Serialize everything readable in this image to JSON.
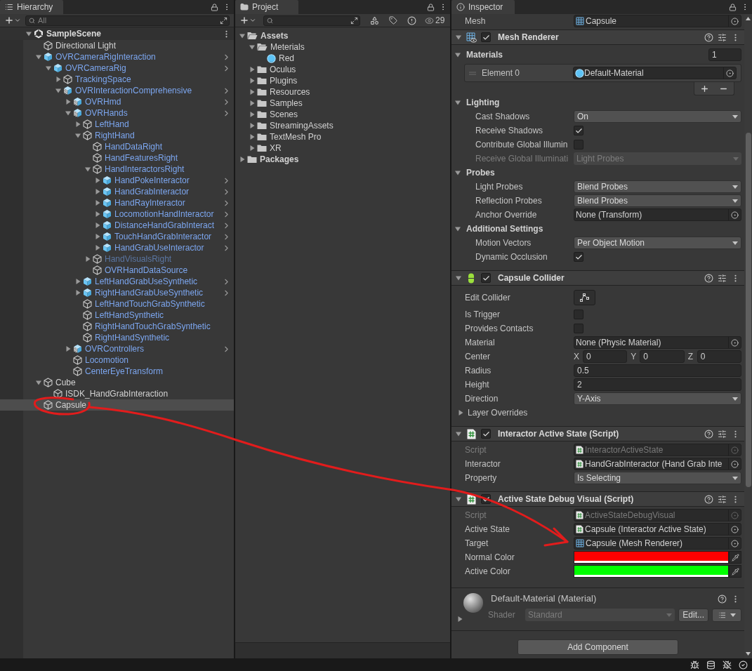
{
  "hierarchy": {
    "tab": "Hierarchy",
    "search": {
      "placeholder": "All"
    },
    "items": [
      {
        "name": "SampleScene",
        "kind": "scene",
        "expanded": true,
        "selected": false,
        "children": [
          {
            "name": "Directional Light",
            "kind": "object",
            "prefab_instance": false,
            "selected": false
          },
          {
            "name": "OVRCameraRigInteraction",
            "kind": "prefab",
            "prefab_instance": true,
            "expanded": true,
            "selected": false,
            "children": [
              {
                "name": "OVRCameraRig",
                "kind": "prefab",
                "prefab_instance": true,
                "expanded": true,
                "selected": false,
                "children": [
                  {
                    "name": "TrackingSpace",
                    "kind": "object",
                    "prefab_instance": true,
                    "expanded": false,
                    "selected": false
                  },
                  {
                    "name": "OVRInteractionComprehensive",
                    "kind": "prefab-variant",
                    "prefab_instance": true,
                    "expanded": true,
                    "selected": false,
                    "children": [
                      {
                        "name": "OVRHmd",
                        "kind": "prefab-variant",
                        "prefab_instance": true,
                        "expanded": false,
                        "selected": false
                      },
                      {
                        "name": "OVRHands",
                        "kind": "prefab-variant",
                        "prefab_instance": true,
                        "expanded": true,
                        "selected": false,
                        "children": [
                          {
                            "name": "LeftHand",
                            "kind": "object",
                            "prefab_instance": true,
                            "expanded": false,
                            "selected": false
                          },
                          {
                            "name": "RightHand",
                            "kind": "object",
                            "prefab_instance": true,
                            "expanded": true,
                            "selected": false,
                            "children": [
                              {
                                "name": "HandDataRight",
                                "kind": "object",
                                "prefab_instance": true,
                                "selected": false
                              },
                              {
                                "name": "HandFeaturesRight",
                                "kind": "object",
                                "prefab_instance": true,
                                "selected": false
                              },
                              {
                                "name": "HandInteractorsRight",
                                "kind": "object",
                                "prefab_instance": true,
                                "expanded": true,
                                "selected": false,
                                "children": [
                                  {
                                    "name": "HandPokeInteractor",
                                    "kind": "prefab",
                                    "prefab_instance": true,
                                    "expanded": false,
                                    "selected": false
                                  },
                                  {
                                    "name": "HandGrabInteractor",
                                    "kind": "prefab",
                                    "prefab_instance": true,
                                    "expanded": false,
                                    "selected": false
                                  },
                                  {
                                    "name": "HandRayInteractor",
                                    "kind": "prefab",
                                    "prefab_instance": true,
                                    "expanded": false,
                                    "selected": false
                                  },
                                  {
                                    "name": "LocomotionHandInteractor",
                                    "kind": "prefab",
                                    "prefab_instance": true,
                                    "expanded": false,
                                    "selected": false
                                  },
                                  {
                                    "name": "DistanceHandGrabInteract",
                                    "kind": "prefab",
                                    "prefab_instance": true,
                                    "expanded": false,
                                    "selected": false
                                  },
                                  {
                                    "name": "TouchHandGrabInteractor",
                                    "kind": "prefab",
                                    "prefab_instance": true,
                                    "expanded": false,
                                    "selected": false
                                  },
                                  {
                                    "name": "HandGrabUseInteractor",
                                    "kind": "prefab",
                                    "prefab_instance": true,
                                    "expanded": false,
                                    "selected": false
                                  }
                                ]
                              },
                              {
                                "name": "HandVisualsRight",
                                "kind": "object",
                                "prefab_instance": true,
                                "expanded": false,
                                "disabled": true,
                                "selected": false
                              },
                              {
                                "name": "OVRHandDataSource",
                                "kind": "object",
                                "prefab_instance": true,
                                "selected": false
                              }
                            ]
                          },
                          {
                            "name": "LeftHandGrabUseSynthetic",
                            "kind": "prefab",
                            "prefab_instance": true,
                            "expanded": false,
                            "selected": false
                          },
                          {
                            "name": "RightHandGrabUseSynthetic",
                            "kind": "prefab",
                            "prefab_instance": true,
                            "expanded": false,
                            "selected": false
                          },
                          {
                            "name": "LeftHandTouchGrabSynthetic",
                            "kind": "object",
                            "prefab_instance": true,
                            "selected": false
                          },
                          {
                            "name": "LeftHandSynthetic",
                            "kind": "object",
                            "prefab_instance": true,
                            "selected": false
                          },
                          {
                            "name": "RightHandTouchGrabSynthetic",
                            "kind": "object",
                            "prefab_instance": true,
                            "selected": false
                          },
                          {
                            "name": "RightHandSynthetic",
                            "kind": "object",
                            "prefab_instance": true,
                            "selected": false
                          }
                        ]
                      },
                      {
                        "name": "OVRControllers",
                        "kind": "prefab-variant",
                        "prefab_instance": true,
                        "expanded": false,
                        "selected": false
                      },
                      {
                        "name": "Locomotion",
                        "kind": "object",
                        "prefab_instance": true,
                        "selected": false
                      },
                      {
                        "name": "CenterEyeTransform",
                        "kind": "object",
                        "prefab_instance": true,
                        "selected": false
                      }
                    ]
                  }
                ]
              }
            ]
          },
          {
            "name": "Cube",
            "kind": "object",
            "prefab_instance": false,
            "expanded": true,
            "selected": false,
            "children": [
              {
                "name": "ISDK_HandGrabInteraction",
                "kind": "object",
                "prefab_instance": false,
                "selected": false
              }
            ]
          },
          {
            "name": "Capsule",
            "kind": "object",
            "prefab_instance": false,
            "selected": true
          }
        ]
      }
    ]
  },
  "project": {
    "tab": "Project",
    "count": "29",
    "items": [
      {
        "name": "Assets",
        "kind": "folder",
        "expanded": true,
        "children": [
          {
            "name": "Meterials",
            "kind": "folder",
            "expanded": true,
            "children": [
              {
                "name": "Red",
                "kind": "material"
              }
            ]
          },
          {
            "name": "Oculus",
            "kind": "folder",
            "expanded": false
          },
          {
            "name": "Plugins",
            "kind": "folder",
            "expanded": false
          },
          {
            "name": "Resources",
            "kind": "folder",
            "expanded": false
          },
          {
            "name": "Samples",
            "kind": "folder",
            "expanded": false
          },
          {
            "name": "Scenes",
            "kind": "folder",
            "expanded": false
          },
          {
            "name": "StreamingAssets",
            "kind": "folder",
            "expanded": false
          },
          {
            "name": "TextMesh Pro",
            "kind": "folder",
            "expanded": false
          },
          {
            "name": "XR",
            "kind": "folder",
            "expanded": false
          }
        ]
      },
      {
        "name": "Packages",
        "kind": "folder",
        "expanded": false
      }
    ]
  },
  "inspector": {
    "tab": "Inspector",
    "top_row": {
      "kind": "object-mesh",
      "label": "Mesh",
      "value": "Capsule"
    },
    "components": [
      {
        "title": "Mesh Renderer",
        "kind": "mesh",
        "enabled": true,
        "expanded": true,
        "rows": [
          {
            "kind": "array",
            "label": "Materials",
            "count": "1",
            "expanded": true,
            "elements": [
              {
                "kind": "object-material",
                "label": "Element 0",
                "value": "Default-Material"
              }
            ]
          },
          {
            "kind": "section",
            "label": "Lighting",
            "expanded": true,
            "rows": [
              {
                "kind": "dropdown",
                "label": "Cast Shadows",
                "value": "On"
              },
              {
                "kind": "checkbox",
                "label": "Receive Shadows",
                "checked": true
              },
              {
                "kind": "checkbox",
                "label": "Contribute Global Illumin",
                "checked": false
              },
              {
                "kind": "dropdown",
                "label": "Receive Global Illuminati",
                "value": "Light Probes",
                "disabled": true
              }
            ]
          },
          {
            "kind": "section",
            "label": "Probes",
            "expanded": true,
            "rows": [
              {
                "kind": "dropdown",
                "label": "Light Probes",
                "value": "Blend Probes"
              },
              {
                "kind": "dropdown",
                "label": "Reflection Probes",
                "value": "Blend Probes"
              },
              {
                "kind": "object",
                "label": "Anchor Override",
                "value": "None (Transform)"
              }
            ]
          },
          {
            "kind": "section",
            "label": "Additional Settings",
            "expanded": true,
            "rows": [
              {
                "kind": "dropdown",
                "label": "Motion Vectors",
                "value": "Per Object Motion"
              },
              {
                "kind": "checkbox",
                "label": "Dynamic Occlusion",
                "checked": true
              }
            ]
          }
        ]
      },
      {
        "title": "Capsule Collider",
        "kind": "capsule",
        "enabled": true,
        "expanded": true,
        "rows": [
          {
            "kind": "edit-button",
            "label": "Edit Collider"
          },
          {
            "kind": "checkbox",
            "label": "Is Trigger",
            "checked": false
          },
          {
            "kind": "checkbox",
            "label": "Provides Contacts",
            "checked": false
          },
          {
            "kind": "object",
            "label": "Material",
            "value": "None (Physic Material)"
          },
          {
            "kind": "vector3",
            "label": "Center",
            "axes": [
              {
                "axis": "X",
                "value": "0"
              },
              {
                "axis": "Y",
                "value": "0"
              },
              {
                "axis": "Z",
                "value": "0"
              }
            ]
          },
          {
            "kind": "number",
            "label": "Radius",
            "value": "0.5"
          },
          {
            "kind": "number",
            "label": "Height",
            "value": "2"
          },
          {
            "kind": "dropdown",
            "label": "Direction",
            "value": "Y-Axis"
          },
          {
            "kind": "foldout",
            "label": "Layer Overrides",
            "expanded": false
          }
        ]
      },
      {
        "title": "Interactor Active State (Script)",
        "kind": "script",
        "enabled": true,
        "expanded": true,
        "rows": [
          {
            "kind": "object-script",
            "label": "Script",
            "value": "InteractorActiveState",
            "disabled": true
          },
          {
            "kind": "object-script",
            "label": "Interactor",
            "value": "HandGrabInteractor (Hand Grab Inte"
          },
          {
            "kind": "dropdown",
            "label": "Property",
            "value": "Is Selecting"
          }
        ]
      },
      {
        "title": "Active State Debug Visual (Script)",
        "kind": "script",
        "enabled": true,
        "expanded": true,
        "rows": [
          {
            "kind": "object-script",
            "label": "Script",
            "value": "ActiveStateDebugVisual",
            "disabled": true
          },
          {
            "kind": "object-script",
            "label": "Active State",
            "value": "Capsule (Interactor Active State)"
          },
          {
            "kind": "object-mesh",
            "label": "Target",
            "value": "Capsule (Mesh Renderer)"
          },
          {
            "kind": "color",
            "label": "Normal Color",
            "color": "#ff0000"
          },
          {
            "kind": "color",
            "label": "Active Color",
            "color": "#00ff00"
          }
        ]
      }
    ],
    "material": {
      "name": "Default-Material (Material)",
      "shader_label": "Shader",
      "shader": "Standard",
      "edit_button": "Edit...",
      "expanded": false
    },
    "add_component": "Add Component"
  }
}
